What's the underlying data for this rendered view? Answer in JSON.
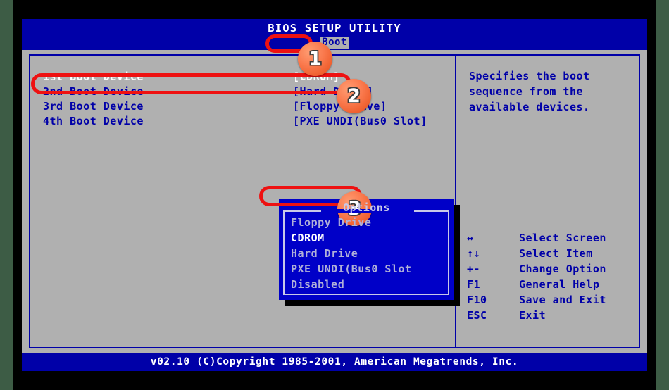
{
  "window": {
    "title": "BIOS SETUP UTILITY",
    "active_tab": "Boot"
  },
  "colors": {
    "screen_blue": "#0000a8",
    "panel_gray": "#b0b0b0",
    "popup_blue": "#0000c8",
    "highlight_white": "#ffffff",
    "annotation_red": "#ee1111",
    "annotation_circle": "#f4703c"
  },
  "boot_list": {
    "rows": [
      {
        "label": "1st Boot Device",
        "value": "[CDROM]",
        "selected": true
      },
      {
        "label": "2nd Boot Device",
        "value": "[Hard Drive]",
        "selected": false
      },
      {
        "label": "3rd Boot Device",
        "value": "[Floppy Drive]",
        "selected": false
      },
      {
        "label": "4th Boot Device",
        "value": "[PXE UNDI(Bus0 Slot]",
        "selected": false
      }
    ]
  },
  "options_popup": {
    "title": "Options",
    "items": [
      {
        "label": "Floppy Drive",
        "selected": false
      },
      {
        "label": "CDROM",
        "selected": true
      },
      {
        "label": "Hard Drive",
        "selected": false
      },
      {
        "label": "PXE UNDI(Bus0 Slot",
        "selected": false
      },
      {
        "label": "Disabled",
        "selected": false
      }
    ]
  },
  "help": {
    "text": "Specifies the boot sequence from the available devices."
  },
  "key_legend": {
    "rows": [
      {
        "key": "↔",
        "desc": "Select Screen"
      },
      {
        "key": "↑↓",
        "desc": "Select Item"
      },
      {
        "key": "+-",
        "desc": "Change Option"
      },
      {
        "key": "F1",
        "desc": "General Help"
      },
      {
        "key": "F10",
        "desc": "Save and Exit"
      },
      {
        "key": "ESC",
        "desc": "Exit"
      }
    ]
  },
  "footer": {
    "text": "v02.10 (C)Copyright 1985-2001, American Megatrends, Inc."
  },
  "annotations": {
    "badges": [
      {
        "number": "1"
      },
      {
        "number": "2"
      },
      {
        "number": "3"
      }
    ]
  }
}
